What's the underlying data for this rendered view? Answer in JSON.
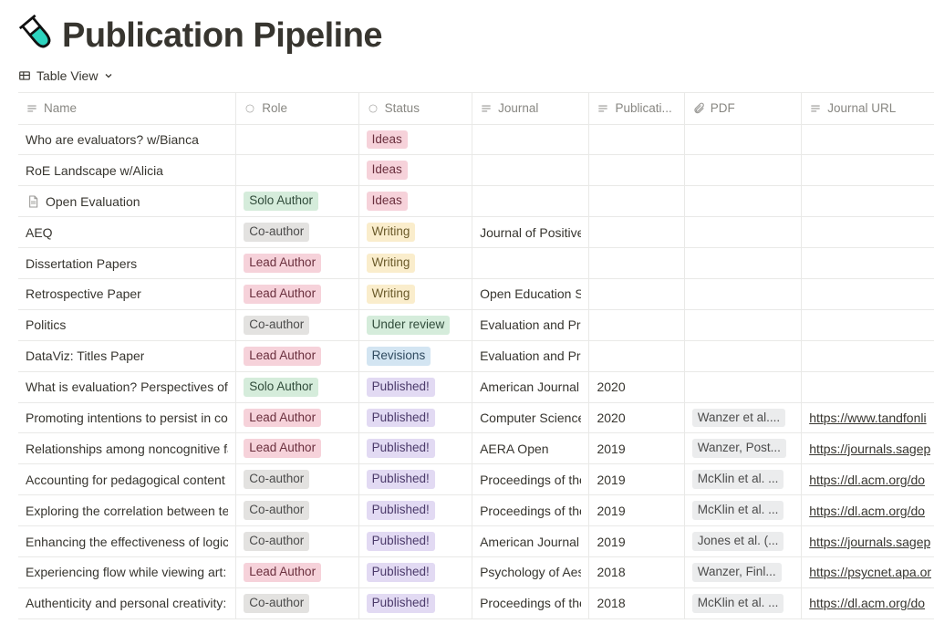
{
  "pageTitle": "Publication Pipeline",
  "viewLabel": "Table View",
  "columns": {
    "name": "Name",
    "role": "Role",
    "status": "Status",
    "journal": "Journal",
    "publication": "Publicati...",
    "pdf": "PDF",
    "journalUrl": "Journal URL"
  },
  "tagColors": {
    "SoloAuthor": {
      "bg": "#d5ecdb",
      "fg": "#304b3a"
    },
    "Co-author": {
      "bg": "#e3e2e0",
      "fg": "#4c4c4c"
    },
    "LeadAuthor": {
      "bg": "#f6d2da",
      "fg": "#6a2f3d"
    },
    "Ideas": {
      "bg": "#f6d2da",
      "fg": "#6a2f3d"
    },
    "Writing": {
      "bg": "#faedcc",
      "fg": "#6a5a2a"
    },
    "Underreview": {
      "bg": "#d5ecdb",
      "fg": "#304b3a"
    },
    "Revisions": {
      "bg": "#d3e5f2",
      "fg": "#2f4a5f"
    },
    "Published!": {
      "bg": "#e2daf3",
      "fg": "#4b3a6a"
    }
  },
  "rows": [
    {
      "name": "Who are evaluators? w/Bianca",
      "role": "",
      "status": "Ideas",
      "journal": "",
      "pub": "",
      "pdf": "",
      "url": "",
      "hasIcon": false
    },
    {
      "name": "RoE Landscape w/Alicia",
      "role": "",
      "status": "Ideas",
      "journal": "",
      "pub": "",
      "pdf": "",
      "url": "",
      "hasIcon": false
    },
    {
      "name": "Open Evaluation",
      "role": "Solo Author",
      "status": "Ideas",
      "journal": "",
      "pub": "",
      "pdf": "",
      "url": "",
      "hasIcon": true
    },
    {
      "name": "AEQ",
      "role": "Co-author",
      "status": "Writing",
      "journal": "Journal of Positive ",
      "pub": "",
      "pdf": "",
      "url": "",
      "hasIcon": false
    },
    {
      "name": "Dissertation Papers",
      "role": "Lead Author",
      "status": "Writing",
      "journal": "",
      "pub": "",
      "pdf": "",
      "url": "",
      "hasIcon": false
    },
    {
      "name": "Retrospective Paper",
      "role": "Lead Author",
      "status": "Writing",
      "journal": "Open Education Stu",
      "pub": "",
      "pdf": "",
      "url": "",
      "hasIcon": false
    },
    {
      "name": "Politics",
      "role": "Co-author",
      "status": "Under review",
      "journal": "Evaluation and Pro",
      "pub": "",
      "pdf": "",
      "url": "",
      "hasIcon": false
    },
    {
      "name": "DataViz: Titles Paper",
      "role": "Lead Author",
      "status": "Revisions",
      "journal": "Evaluation and Pro",
      "pub": "",
      "pdf": "",
      "url": "",
      "hasIcon": false
    },
    {
      "name": "What is evaluation? Perspectives of h",
      "role": "Solo Author",
      "status": "Published!",
      "journal": "American Journal o",
      "pub": "2020",
      "pdf": "",
      "url": "",
      "hasIcon": false
    },
    {
      "name": "Promoting intentions to persist in co",
      "role": "Lead Author",
      "status": "Published!",
      "journal": "Computer Science",
      "pub": "2020",
      "pdf": "Wanzer et al....",
      "url": "https://www.tandfonli",
      "hasIcon": false
    },
    {
      "name": "Relationships among noncognitive fa",
      "role": "Lead Author",
      "status": "Published!",
      "journal": "AERA Open",
      "pub": "2019",
      "pdf": "Wanzer, Post...",
      "url": "https://journals.sagep",
      "hasIcon": false
    },
    {
      "name": "Accounting for pedagogical content ",
      "role": "Co-author",
      "status": "Published!",
      "journal": "Proceedings of the",
      "pub": "2019",
      "pdf": "McKlin et al. ...",
      "url": "https://dl.acm.org/do",
      "hasIcon": false
    },
    {
      "name": "Exploring the correlation between te",
      "role": "Co-author",
      "status": "Published!",
      "journal": "Proceedings of the",
      "pub": "2019",
      "pdf": "McKlin et al. ...",
      "url": "https://dl.acm.org/do",
      "hasIcon": false
    },
    {
      "name": "Enhancing the effectiveness of logic ",
      "role": "Co-author",
      "status": "Published!",
      "journal": "American Journal o",
      "pub": "2019",
      "pdf": "Jones et al. (...",
      "url": "https://journals.sagep",
      "hasIcon": false
    },
    {
      "name": "Experiencing flow while viewing art: ",
      "role": "Lead Author",
      "status": "Published!",
      "journal": "Psychology of Aest",
      "pub": "2018",
      "pdf": "Wanzer, Finl...",
      "url": "https://psycnet.apa.or",
      "hasIcon": false
    },
    {
      "name": "Authenticity and personal creativity: ",
      "role": "Co-author",
      "status": "Published!",
      "journal": "Proceedings of the",
      "pub": "2018",
      "pdf": "McKlin et al. ...",
      "url": "https://dl.acm.org/do",
      "hasIcon": false
    }
  ]
}
